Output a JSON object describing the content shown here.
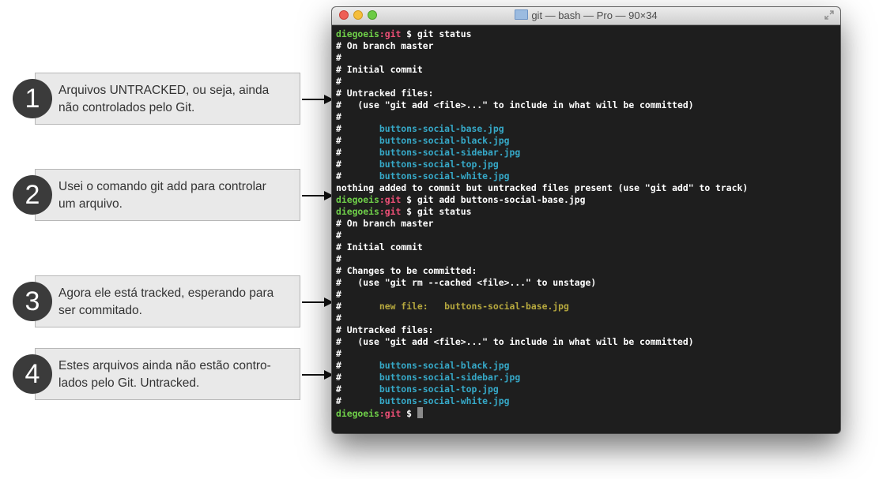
{
  "callouts": [
    {
      "number": "1",
      "text": "Arquivos UNTRACKED, ou seja, ainda\nnão controlados pelo Git."
    },
    {
      "number": "2",
      "text": "Usei o comando git add para controlar\num arquivo."
    },
    {
      "number": "3",
      "text": "Agora ele está tracked, esperando para\nser commitado."
    },
    {
      "number": "4",
      "text": "Estes arquivos ainda não estão contro-\nlados pelo Git. Untracked."
    }
  ],
  "window": {
    "title": "git — bash — Pro — 90×34",
    "icons": [
      "close-light",
      "minimize-light",
      "zoom-light",
      "folder-icon",
      "fullscreen-icon"
    ]
  },
  "terminal": {
    "prompt_user": "diegoeis",
    "prompt_sep": ":",
    "prompt_dir": "git",
    "prompt_symbol": " $ ",
    "lines": [
      {
        "prompt": true,
        "cmd": "git status"
      },
      {
        "text": "# On branch master"
      },
      {
        "text": "#"
      },
      {
        "text": "# Initial commit"
      },
      {
        "text": "#"
      },
      {
        "text": "# Untracked files:"
      },
      {
        "text": "#   (use \"git add <file>...\" to include in what will be committed)"
      },
      {
        "text": "#"
      },
      {
        "text": "#",
        "file": "\tbuttons-social-base.jpg"
      },
      {
        "text": "#",
        "file": "\tbuttons-social-black.jpg"
      },
      {
        "text": "#",
        "file": "\tbuttons-social-sidebar.jpg"
      },
      {
        "text": "#",
        "file": "\tbuttons-social-top.jpg"
      },
      {
        "text": "#",
        "file": "\tbuttons-social-white.jpg"
      },
      {
        "text": "nothing added to commit but untracked files present (use \"git add\" to track)"
      },
      {
        "prompt": true,
        "cmd": "git add buttons-social-base.jpg"
      },
      {
        "prompt": true,
        "cmd": "git status"
      },
      {
        "text": "# On branch master"
      },
      {
        "text": "#"
      },
      {
        "text": "# Initial commit"
      },
      {
        "text": "#"
      },
      {
        "text": "# Changes to be committed:"
      },
      {
        "text": "#   (use \"git rm --cached <file>...\" to unstage)"
      },
      {
        "text": "#"
      },
      {
        "text": "#",
        "newfile": "\tnew file:   buttons-social-base.jpg"
      },
      {
        "text": "#"
      },
      {
        "text": "# Untracked files:"
      },
      {
        "text": "#   (use \"git add <file>...\" to include in what will be committed)"
      },
      {
        "text": "#"
      },
      {
        "text": "#",
        "file": "\tbuttons-social-black.jpg"
      },
      {
        "text": "#",
        "file": "\tbuttons-social-sidebar.jpg"
      },
      {
        "text": "#",
        "file": "\tbuttons-social-top.jpg"
      },
      {
        "text": "#",
        "file": "\tbuttons-social-white.jpg"
      },
      {
        "prompt": true,
        "cmd": "",
        "cursor": true
      }
    ]
  },
  "colors": {
    "prompt_user": "#6fcf49",
    "prompt_dir": "#ec4f76",
    "untracked_file": "#36a9c8",
    "staged_file": "#b6a83e",
    "terminal_bg": "#1e1e1e"
  }
}
